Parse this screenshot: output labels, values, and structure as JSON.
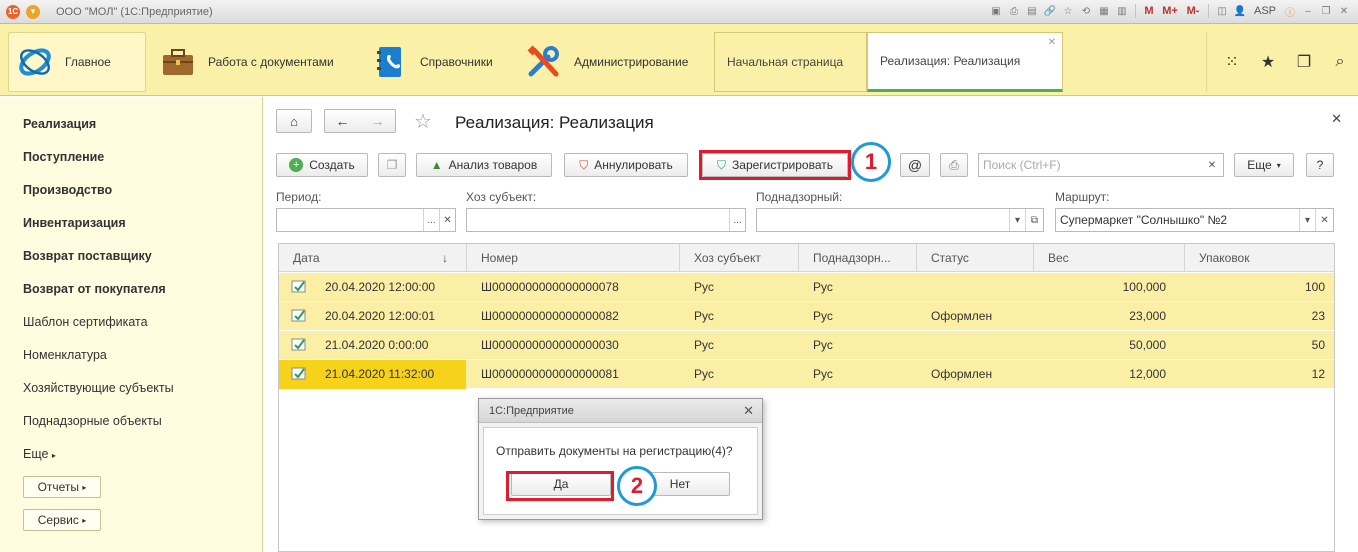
{
  "titlebar": {
    "title": "ООО \"МОЛ\"  (1С:Предприятие)",
    "icons": [
      "save-icon",
      "print-icon",
      "preview-icon",
      "link-icon",
      "favorites-icon",
      "history-icon",
      "calendar-icon",
      "calculator-icon"
    ],
    "memory_buttons": [
      "M",
      "M+",
      "M-"
    ],
    "user": "ASP"
  },
  "sections": {
    "main": "Главное",
    "documents": "Работа с документами",
    "references": "Справочники",
    "admin": "Администрирование"
  },
  "window_tabs": {
    "home": "Начальная страница",
    "current": "Реализация: Реализация"
  },
  "sidebar": {
    "items": [
      {
        "label": "Реализация",
        "bold": true
      },
      {
        "label": "Поступление",
        "bold": true
      },
      {
        "label": "Производство",
        "bold": true
      },
      {
        "label": "Инвентаризация",
        "bold": true
      },
      {
        "label": "Возврат поставщику",
        "bold": true
      },
      {
        "label": "Возврат от покупателя",
        "bold": true
      },
      {
        "label": "Шаблон сертификата",
        "bold": false
      },
      {
        "label": "Номенклатура",
        "bold": false
      },
      {
        "label": "Хозяйствующие субъекты",
        "bold": false
      },
      {
        "label": "Поднадзорные объекты",
        "bold": false
      },
      {
        "label": "Еще",
        "bold": false
      }
    ],
    "reports_btn": "Отчеты",
    "service_btn": "Сервис"
  },
  "page": {
    "title": "Реализация: Реализация"
  },
  "toolbar": {
    "create": "Создать",
    "analysis": "Анализ товаров",
    "annul": "Аннулировать",
    "register": "Зарегистрировать",
    "at": "@",
    "search_placeholder": "Поиск (Ctrl+F)",
    "more": "Еще",
    "help": "?"
  },
  "filters": {
    "period_label": "Период:",
    "subject_label": "Хоз субъект:",
    "supervised_label": "Поднадзорный:",
    "route_label": "Маршрут:",
    "route_value": "Супермаркет \"Солнышко\" №2"
  },
  "table": {
    "columns": [
      "Дата",
      "Номер",
      "Хоз субъект",
      "Поднадзорн...",
      "Статус",
      "Вес",
      "Упаковок"
    ],
    "rows": [
      {
        "date": "20.04.2020 12:00:00",
        "number": "Ш0000000000000000078",
        "subject": "Рус",
        "supervised": "Рус",
        "status": "",
        "weight": "100,000",
        "packs": "100"
      },
      {
        "date": "20.04.2020 12:00:01",
        "number": "Ш0000000000000000082",
        "subject": "Рус",
        "supervised": "Рус",
        "status": "Оформлен",
        "weight": "23,000",
        "packs": "23"
      },
      {
        "date": "21.04.2020 0:00:00",
        "number": "Ш0000000000000000030",
        "subject": "Рус",
        "supervised": "Рус",
        "status": "",
        "weight": "50,000",
        "packs": "50"
      },
      {
        "date": "21.04.2020 11:32:00",
        "number": "Ш0000000000000000081",
        "subject": "Рус",
        "supervised": "Рус",
        "status": "Оформлен",
        "weight": "12,000",
        "packs": "12"
      }
    ]
  },
  "dialog": {
    "title": "1С:Предприятие",
    "message": "Отправить документы на регистрацию(4)?",
    "yes": "Да",
    "no": "Нет"
  },
  "annotations": {
    "step1": "1",
    "step2": "2",
    "highlight_color": "#e01b2d",
    "circle_color": "#1e9ad6"
  }
}
